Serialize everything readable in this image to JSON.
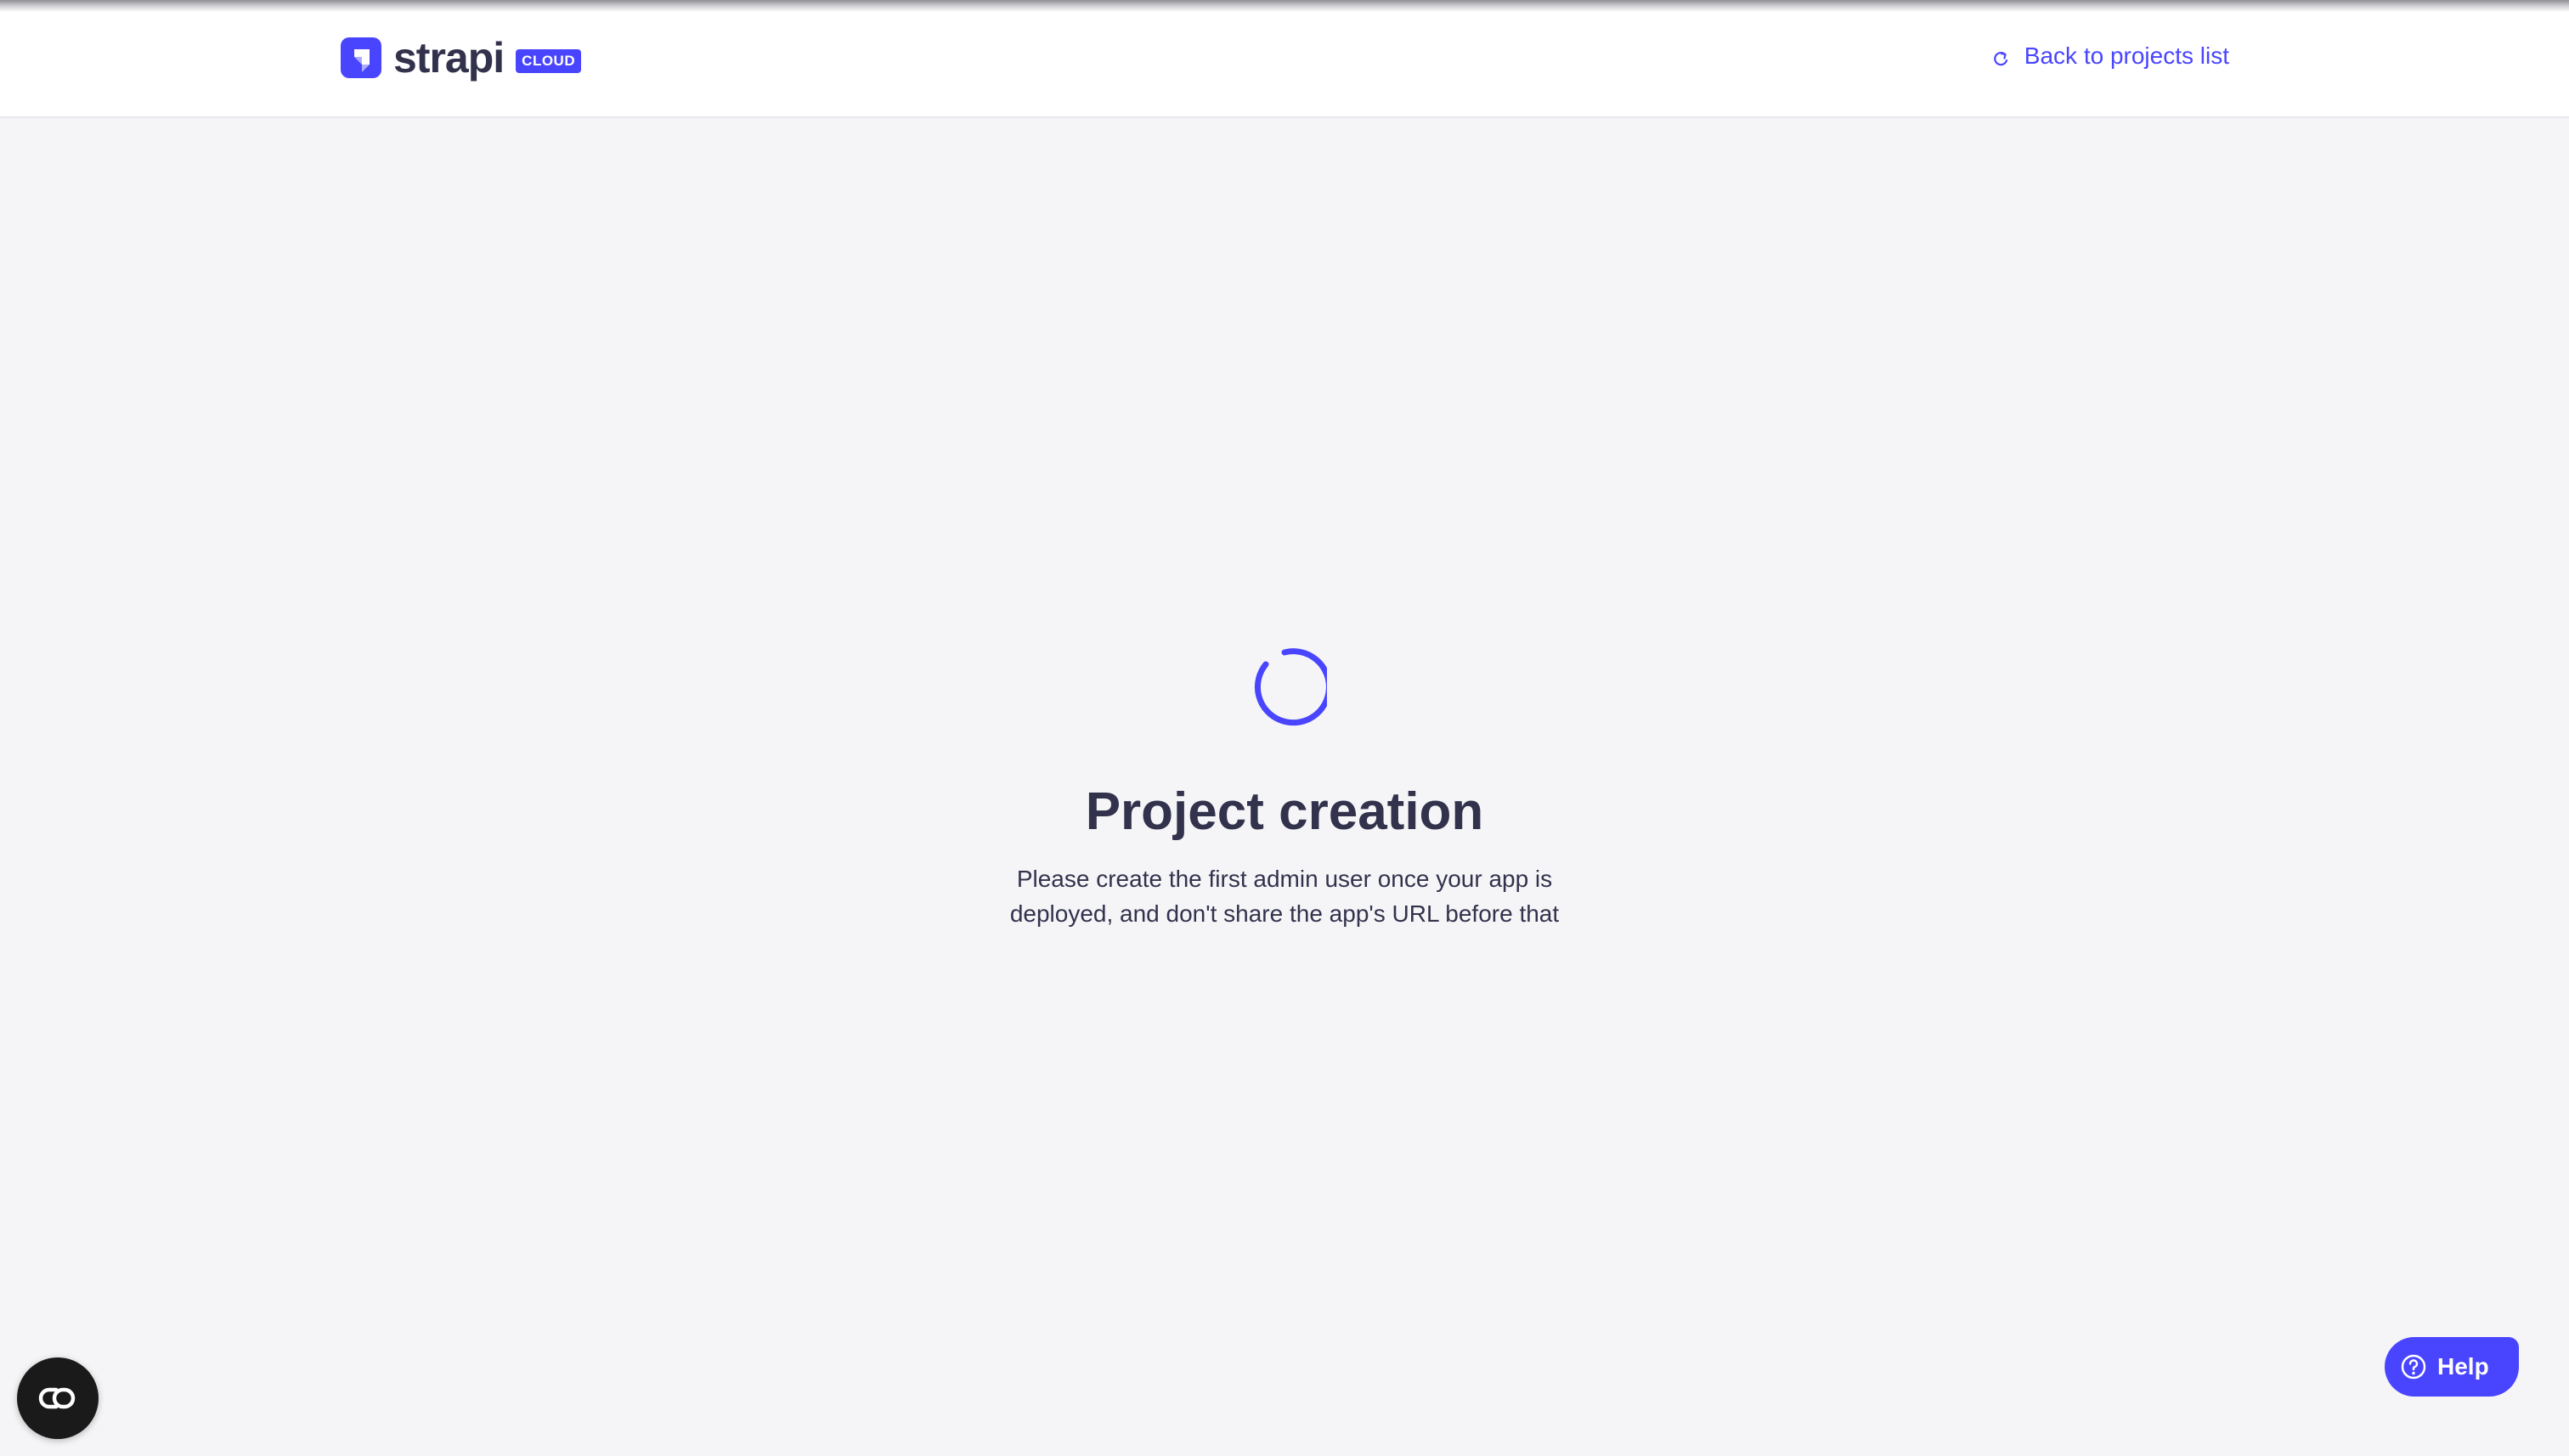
{
  "header": {
    "logo": {
      "wordmark": "strapi",
      "badge": "CLOUD"
    },
    "back_link": {
      "label": "Back to projects list",
      "icon": "back-arrow-icon"
    }
  },
  "main": {
    "status_icon": "loading-spinner-icon",
    "title": "Project creation",
    "description": "Please create the first admin user once your app is deployed, and don't share the app's URL before that"
  },
  "floating": {
    "help_button": {
      "label": "Help",
      "icon": "question-circle-icon"
    },
    "widget_button": {
      "icon": "cc-toggle-icon"
    }
  },
  "colors": {
    "accent": "#4945ff",
    "text": "#32324d",
    "background": "#f5f5f7"
  }
}
